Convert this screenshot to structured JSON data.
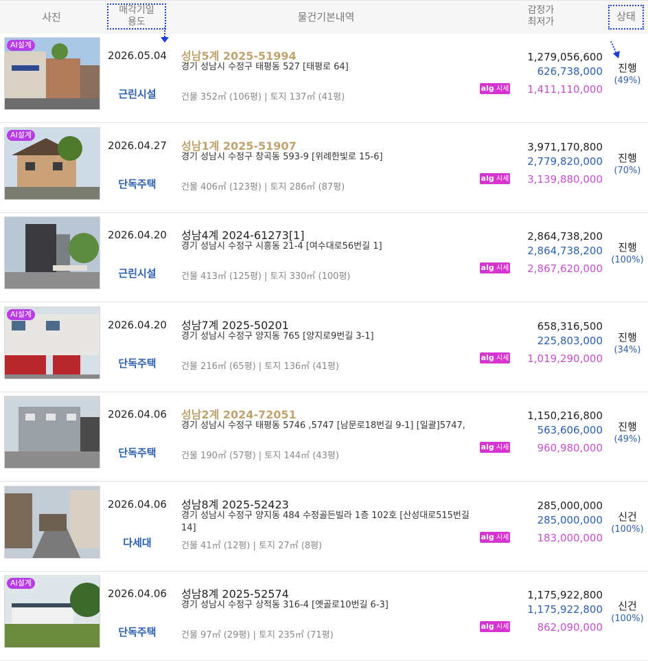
{
  "header": {
    "photo": "사진",
    "date_line1": "매각기일",
    "date_line2": "용도",
    "info": "물건기본내역",
    "price_line1": "감정가",
    "price_line2": "최저가",
    "status": "상태"
  },
  "badge": {
    "ai": "AI설계",
    "alg_brand": "alg",
    "alg_label": "시세"
  },
  "rows": [
    {
      "ai": true,
      "date": "2026.05.04",
      "use": "근린시설",
      "case": "성남5계 2025-51994",
      "gold": true,
      "address": "경기 성남시 수정구 태평동 527 [태평로 64]",
      "area": "건물 352㎡ (106평)   |   토지 137㎡ (41평)",
      "appraisal": "1,279,056,600",
      "minimum": "626,738,000",
      "market": "1,411,110,000",
      "status": "진행",
      "pct": "(49%)"
    },
    {
      "ai": true,
      "date": "2026.04.27",
      "use": "단독주택",
      "case": "성남1계 2025-51907",
      "gold": true,
      "address": "경기 성남시 수정구 창곡동 593-9 [위례한빛로 15-6]",
      "area": "건물 406㎡ (123평)   |   토지 286㎡ (87평)",
      "appraisal": "3,971,170,800",
      "minimum": "2,779,820,000",
      "market": "3,139,880,000",
      "status": "진행",
      "pct": "(70%)"
    },
    {
      "ai": false,
      "date": "2026.04.20",
      "use": "근린시설",
      "case": "성남4계 2024-61273[1]",
      "gold": false,
      "address": "경기 성남시 수정구 시흥동 21-4 [여수대로56번길 1]",
      "area": "건물 413㎡ (125평)   |   토지 330㎡ (100평)",
      "appraisal": "2,864,738,200",
      "minimum": "2,864,738,200",
      "market": "2,867,620,000",
      "status": "진행",
      "pct": "(100%)"
    },
    {
      "ai": true,
      "date": "2026.04.20",
      "use": "단독주택",
      "case": "성남7계 2025-50201",
      "gold": false,
      "address": "경기 성남시 수정구 양지동 765 [양지로9번길 3-1]",
      "area": "건물 216㎡ (65평)   |   토지 136㎡ (41평)",
      "appraisal": "658,316,500",
      "minimum": "225,803,000",
      "market": "1,019,290,000",
      "status": "진행",
      "pct": "(34%)"
    },
    {
      "ai": false,
      "date": "2026.04.06",
      "use": "단독주택",
      "case": "성남2계 2024-72051",
      "gold": true,
      "address": "경기 성남시 수정구 태평동 5746 ,5747 [남문로18번길 9-1]  [일괄]5747,",
      "area": "건물 190㎡ (57평)   |   토지 144㎡ (43평)",
      "appraisal": "1,150,216,800",
      "minimum": "563,606,000",
      "market": "960,980,000",
      "status": "진행",
      "pct": "(49%)"
    },
    {
      "ai": false,
      "date": "2026.04.06",
      "use": "다세대",
      "case": "성남8계 2025-52423",
      "gold": false,
      "address": "경기 성남시 수정구 양지동 484 수정골든빌라 1층 102호 [산성대로515번길 14]",
      "area": "건물 41㎡ (12평)   |   토지 27㎡ (8평)",
      "appraisal": "285,000,000",
      "minimum": "285,000,000",
      "market": "183,000,000",
      "status": "신건",
      "pct": "(100%)"
    },
    {
      "ai": true,
      "date": "2026.04.06",
      "use": "단독주택",
      "case": "성남8계 2025-52574",
      "gold": false,
      "address": "경기 성남시 수정구 상적동 316-4 [옛골로10번길 6-3]",
      "area": "건물 97㎡ (29평)   |   토지 235㎡ (71평)",
      "appraisal": "1,175,922,800",
      "minimum": "1,175,922,800",
      "market": "862,090,000",
      "status": "신건",
      "pct": "(100%)"
    }
  ]
}
